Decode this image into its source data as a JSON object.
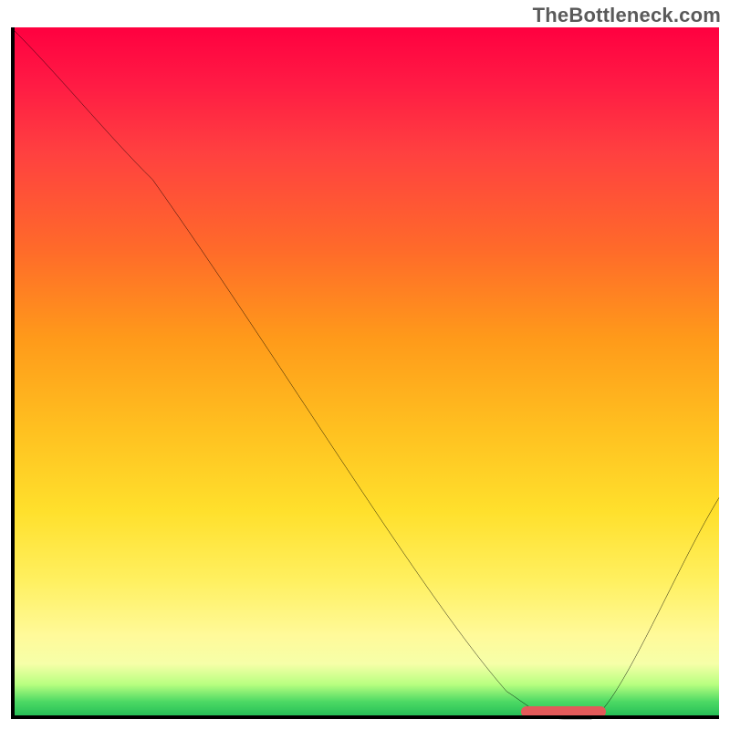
{
  "watermark": "TheBottleneck.com",
  "chart_data": {
    "type": "line",
    "title": "",
    "xlabel": "",
    "ylabel": "",
    "xlim": [
      0,
      100
    ],
    "ylim": [
      0,
      100
    ],
    "series": [
      {
        "name": "bottleneck-curve",
        "x": [
          0,
          20,
          70,
          78,
          82,
          100
        ],
        "y": [
          100,
          78,
          4,
          0,
          0,
          32
        ]
      }
    ],
    "optimal_range_x": [
      72,
      84
    ],
    "gradient_stops": [
      {
        "pos": 0,
        "color": "#ff0040"
      },
      {
        "pos": 0.45,
        "color": "#ff9a1a"
      },
      {
        "pos": 0.8,
        "color": "#fff060"
      },
      {
        "pos": 0.95,
        "color": "#b8ff80"
      },
      {
        "pos": 1.0,
        "color": "#1db954"
      }
    ]
  }
}
